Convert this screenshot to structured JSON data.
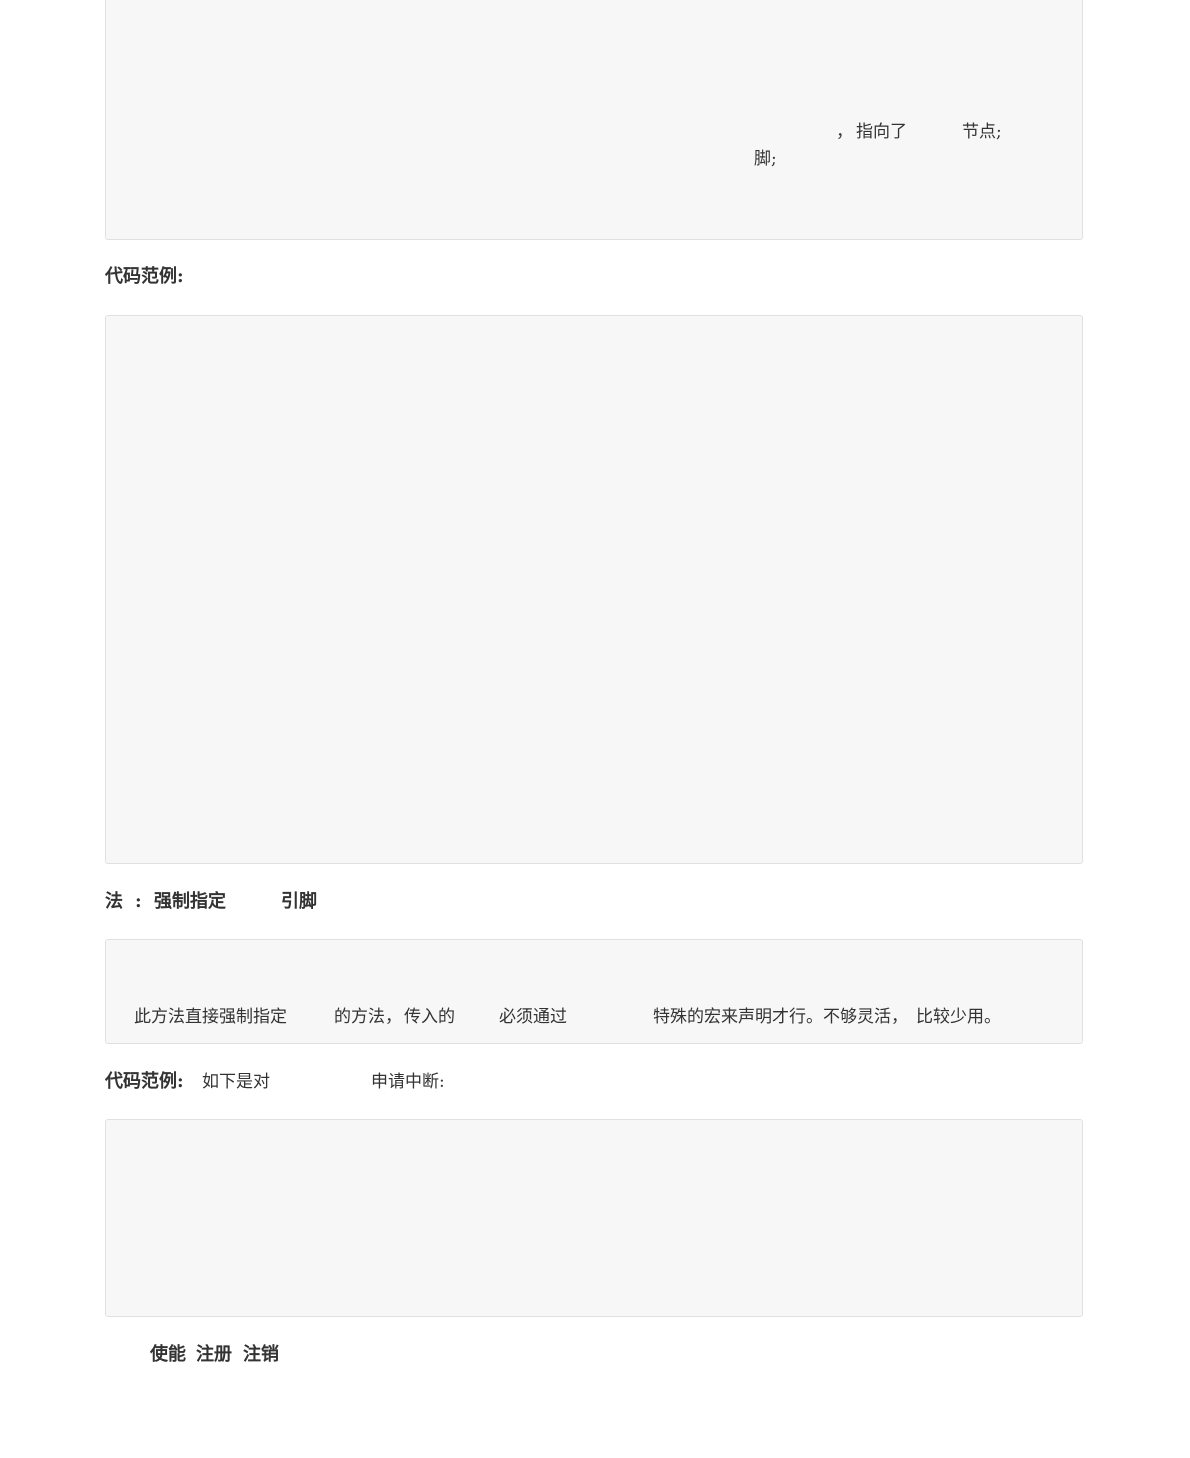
{
  "box1": {
    "fragment_comma": "，",
    "fragment_points_to": "指向了",
    "fragment_node": "节点;",
    "fragment_pin": "脚;"
  },
  "heading1": {
    "label": "代码范例:"
  },
  "heading2": {
    "part1": "法",
    "part2": ":",
    "part3": "强制指定",
    "part4": "引脚"
  },
  "box3": {
    "segment1": "此方法直接强制指定",
    "segment2": "的方法，",
    "segment3": "传入的",
    "segment4": "必须通过",
    "segment5": "特殊的宏来声明才行。不够灵活，",
    "segment6": "比较少用。"
  },
  "heading3": {
    "label": "代码范例:",
    "text_part1": "如下是对",
    "text_part2": "申请中断:"
  },
  "heading4": {
    "word1": "使能",
    "word2": "注册",
    "word3": "注销"
  }
}
